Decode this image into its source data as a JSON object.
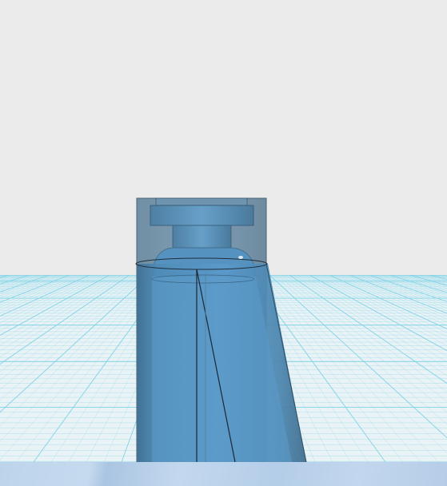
{
  "scene": {
    "background_color": "#ebebeb",
    "grid_color": "#7fd2e6",
    "model_color": "#4e88b1",
    "model_outline_color": "#1f2f3b",
    "bottom_bar_color": "#bcd4ea"
  },
  "icons": {
    "model": "bottle-model-icon"
  }
}
